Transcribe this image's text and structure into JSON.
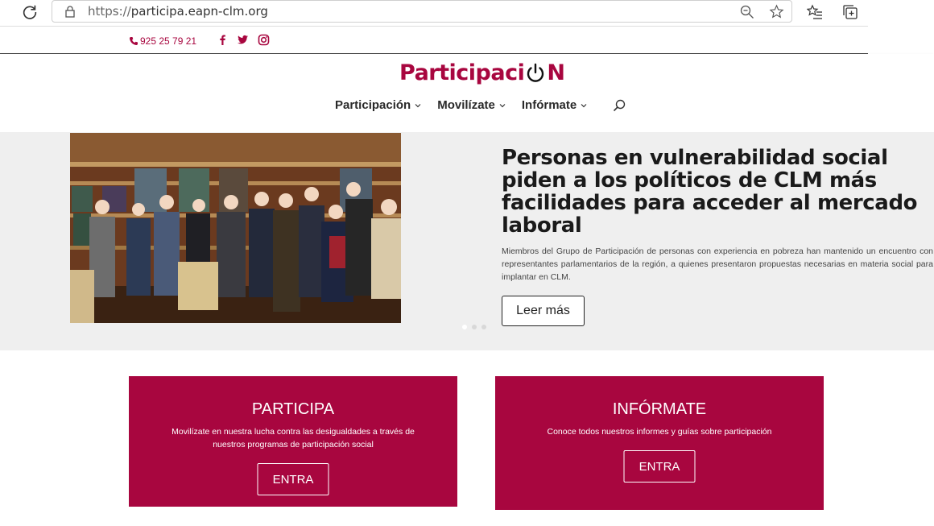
{
  "browser": {
    "url_scheme": "https://",
    "url_host": "participa.eapn-clm.org"
  },
  "topbar": {
    "phone": "925 25 79 21"
  },
  "header": {
    "logo_text": "Participaci",
    "logo_suffix": "N",
    "nav": [
      {
        "label": "Participación"
      },
      {
        "label": "Movilízate"
      },
      {
        "label": "Infórmate"
      }
    ]
  },
  "hero": {
    "title": "Personas en vulnerabilidad social piden a los políticos de CLM más facilidades para acceder al mercado laboral",
    "text": "Miembros del Grupo de Participación de personas con experiencia en pobreza han mantenido un encuentro con representantes parlamentarios de la región, a quienes presentaron propuestas necesarias en materia social para implantar en CLM.",
    "button_label": "Leer más"
  },
  "cards": [
    {
      "title": "PARTICIPA",
      "text": "Movilízate en nuestra lucha contra las desigualdades a través de nuestros programas de participación social",
      "button_label": "ENTRA"
    },
    {
      "title": "INFÓRMATE",
      "text": "Conoce todos nuestros informes y guías sobre participación",
      "button_label": "ENTRA"
    }
  ],
  "colors": {
    "brand": "#a8063f",
    "hero_bg": "#efefef"
  }
}
